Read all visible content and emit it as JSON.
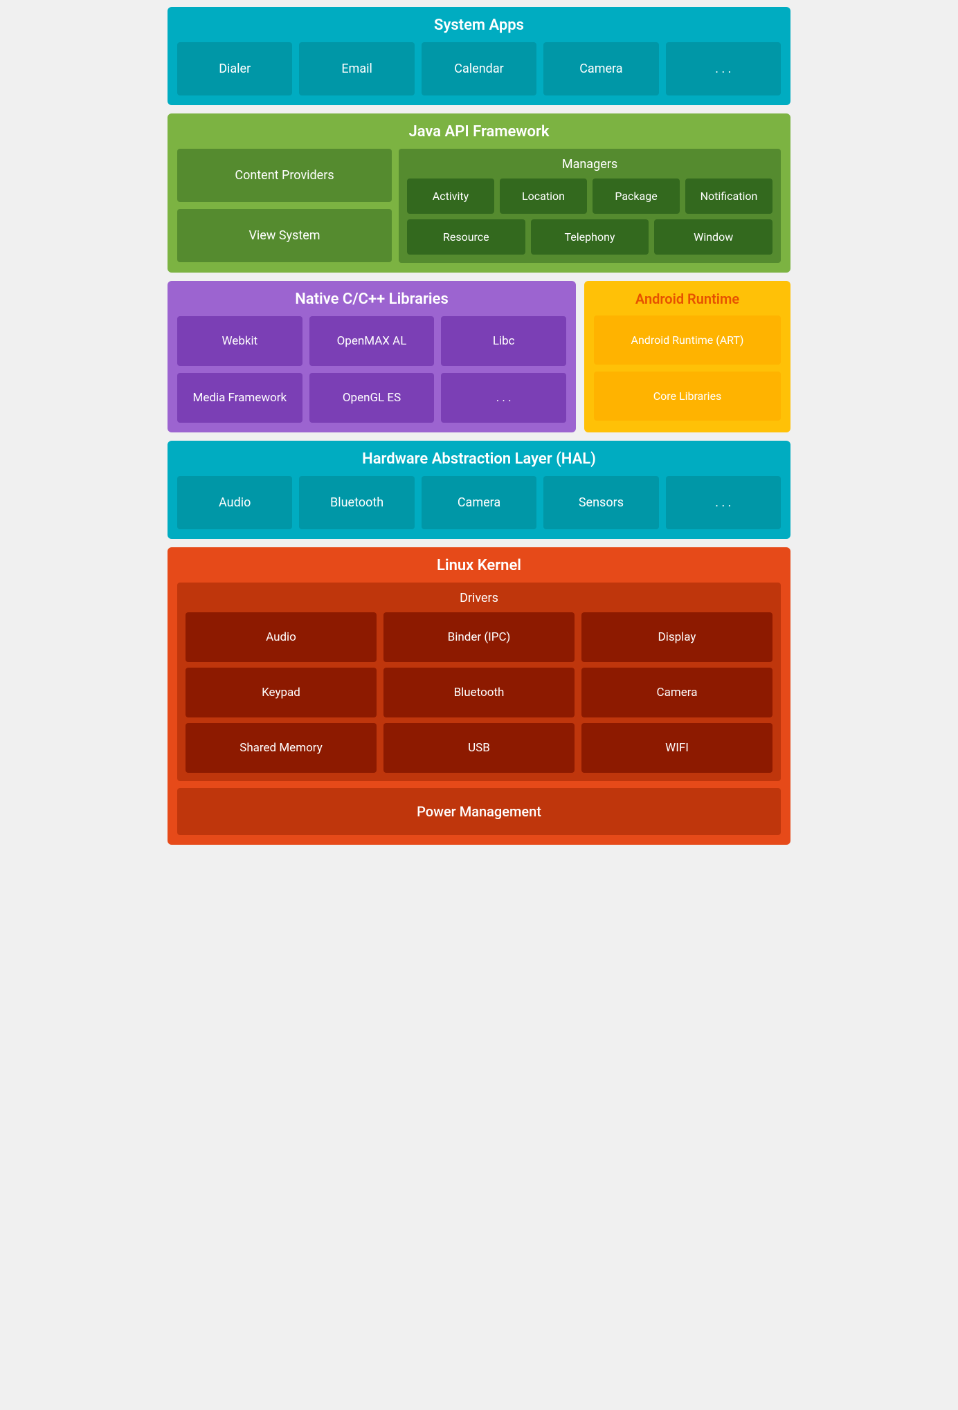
{
  "system_apps": {
    "title": "System Apps",
    "items": [
      "Dialer",
      "Email",
      "Calendar",
      "Camera",
      ". . ."
    ]
  },
  "java_framework": {
    "title": "Java API Framework",
    "left": [
      "Content Providers",
      "View System"
    ],
    "managers": {
      "title": "Managers",
      "row1": [
        "Activity",
        "Location",
        "Package",
        "Notification"
      ],
      "row2": [
        "Resource",
        "Telephony",
        "Window"
      ]
    }
  },
  "native_libs": {
    "title": "Native C/C++ Libraries",
    "row1": [
      "Webkit",
      "OpenMAX AL",
      "Libc"
    ],
    "row2": [
      "Media Framework",
      "OpenGL ES",
      ". . ."
    ]
  },
  "android_runtime": {
    "title": "Android Runtime",
    "items": [
      "Android Runtime (ART)",
      "Core Libraries"
    ]
  },
  "hal": {
    "title": "Hardware Abstraction Layer (HAL)",
    "items": [
      "Audio",
      "Bluetooth",
      "Camera",
      "Sensors",
      ". . ."
    ]
  },
  "linux_kernel": {
    "title": "Linux Kernel",
    "drivers_title": "Drivers",
    "drivers_row1": [
      "Audio",
      "Binder (IPC)",
      "Display"
    ],
    "drivers_row2": [
      "Keypad",
      "Bluetooth",
      "Camera"
    ],
    "drivers_row3": [
      "Shared Memory",
      "USB",
      "WIFI"
    ],
    "power_management": "Power Management"
  }
}
